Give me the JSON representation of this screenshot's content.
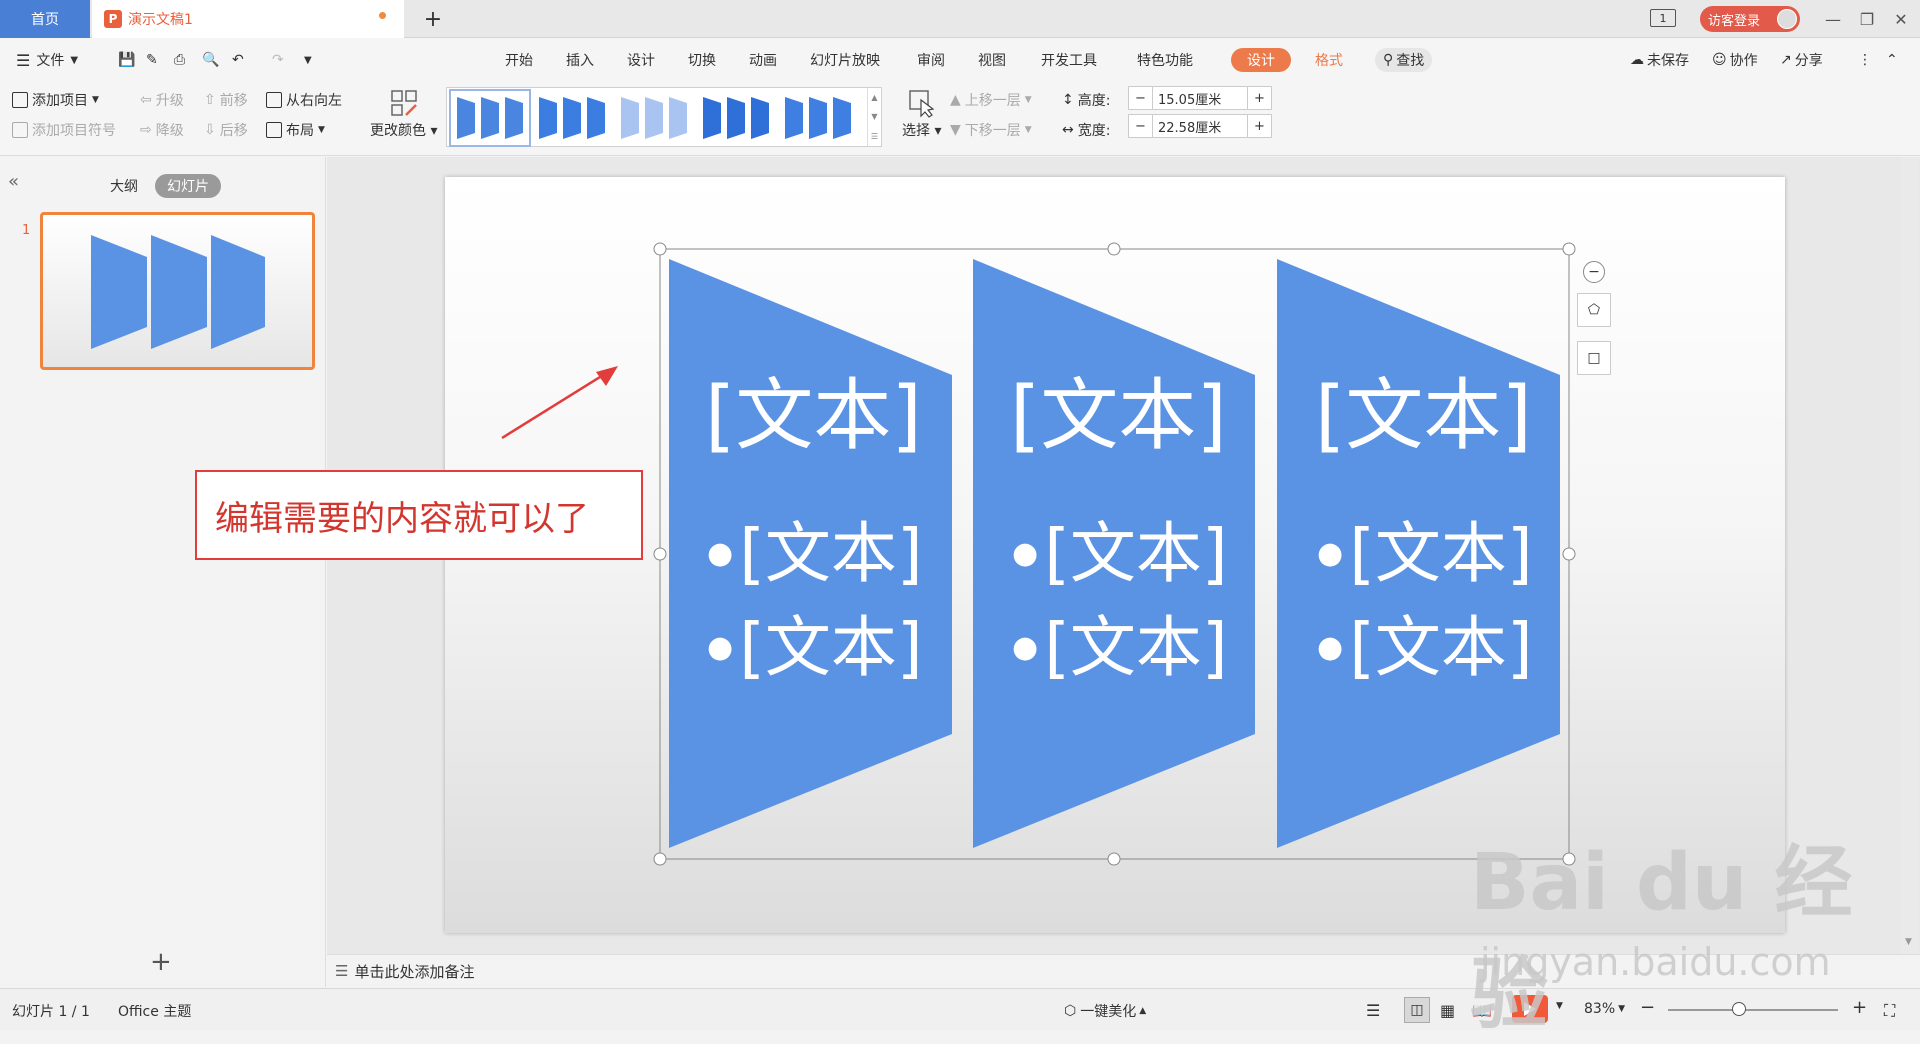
{
  "tabs": {
    "home": "首页",
    "doc_title": "演示文稿1",
    "new_tab": "+"
  },
  "window": {
    "badge": "1",
    "login": "访客登录"
  },
  "menu": {
    "file": "文件",
    "items": [
      "开始",
      "插入",
      "设计",
      "切换",
      "动画",
      "幻灯片放映",
      "审阅",
      "视图",
      "开发工具",
      "特色功能"
    ],
    "design": "设计",
    "format": "格式",
    "search": "查找",
    "unsaved": "未保存",
    "collab": "协作",
    "share": "分享"
  },
  "ribbon": {
    "add_item": "添加项目",
    "add_bullet": "添加项目符号",
    "promote": "升级",
    "demote": "降级",
    "move_up": "前移",
    "move_down": "后移",
    "rtl": "从右向左",
    "layout": "布局",
    "change_color": "更改颜色",
    "select": "选择",
    "bring_forward": "上移一层",
    "send_backward": "下移一层",
    "height_label": "高度:",
    "height_value": "15.05厘米",
    "width_label": "宽度:",
    "width_value": "22.58厘米"
  },
  "left_panel": {
    "outline_tab": "大纲",
    "slides_tab": "幻灯片",
    "slide_number": "1",
    "add": "+"
  },
  "slide": {
    "columns": [
      {
        "title": "[文本]",
        "bullets": [
          "[文本]",
          "[文本]"
        ]
      },
      {
        "title": "[文本]",
        "bullets": [
          "[文本]",
          "[文本]"
        ]
      },
      {
        "title": "[文本]",
        "bullets": [
          "[文本]",
          "[文本]"
        ]
      }
    ],
    "shape_color": "#5b93e4"
  },
  "annotation": {
    "text": "编辑需要的内容就可以了",
    "color": "#e23c3c"
  },
  "notes": {
    "placeholder": "单击此处添加备注"
  },
  "status": {
    "slide_count": "幻灯片 1 / 1",
    "theme": "Office 主题",
    "beautify": "一键美化",
    "zoom": "83%"
  },
  "watermark": {
    "main": "Bai du 经验",
    "url": "jingyan.baidu.com"
  }
}
